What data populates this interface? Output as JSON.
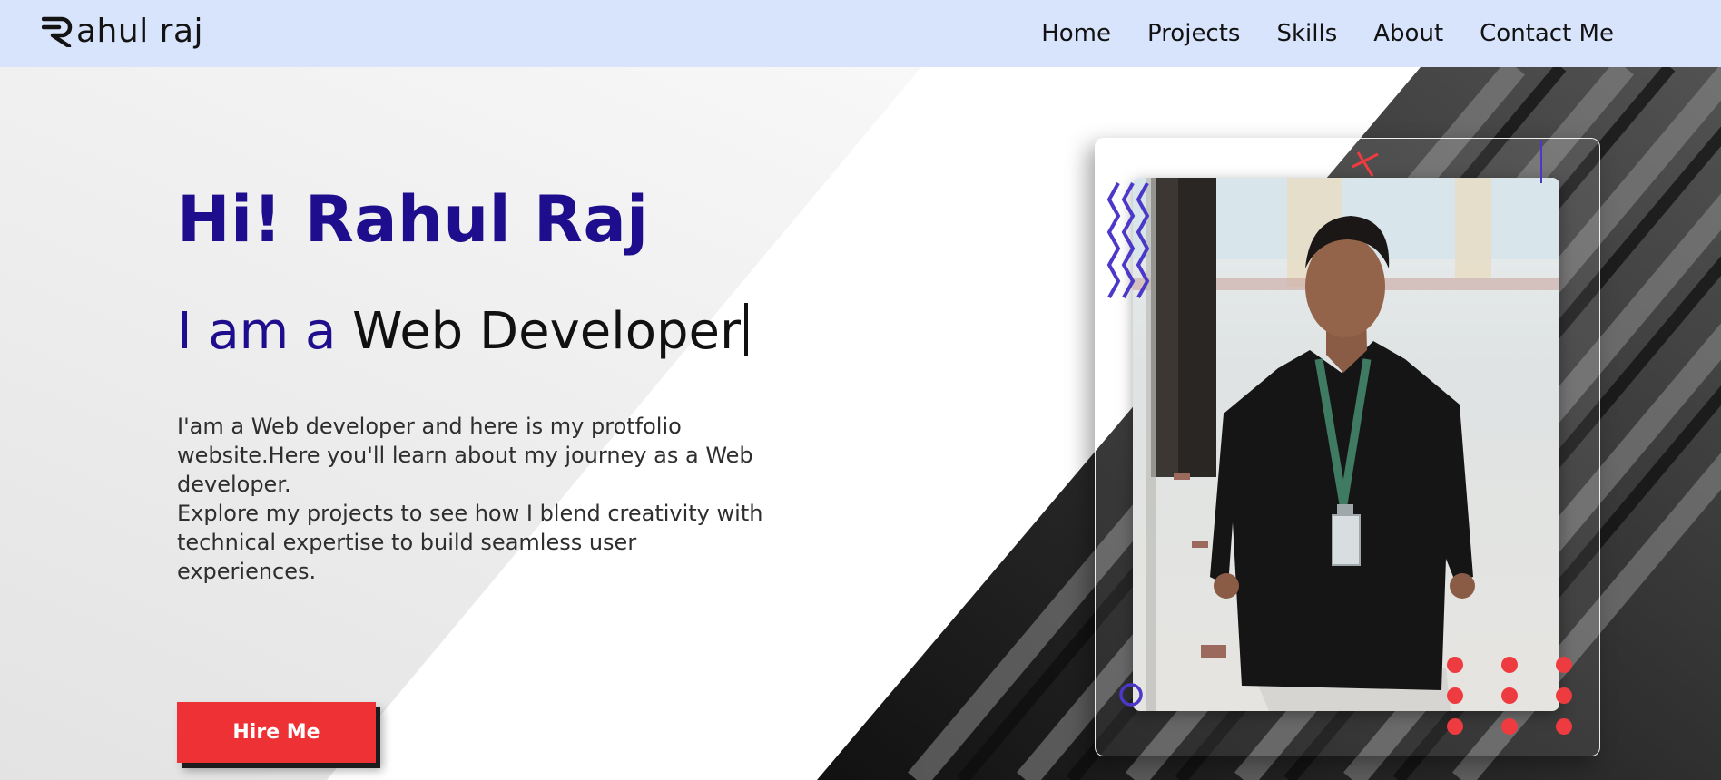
{
  "brand": {
    "name": "ahul raj",
    "logo_letter": "R"
  },
  "nav": {
    "items": [
      {
        "label": "Home"
      },
      {
        "label": "Projects"
      },
      {
        "label": "Skills"
      },
      {
        "label": "About"
      },
      {
        "label": "Contact Me"
      }
    ]
  },
  "hero": {
    "greeting": "Hi! Rahul Raj",
    "role_prefix": "I am a",
    "role_typed": "Web Developer",
    "intro_p1": "I'am a Web developer and here is my protfolio website.Here you'll learn about my journey as a Web developer.",
    "intro_p2": "Explore my projects to see how I blend creativity with technical expertise to build seamless user experiences.",
    "cta_label": "Hire Me"
  },
  "colors": {
    "nav_bg": "#d8e4fb",
    "accent_blue": "#1e0d8c",
    "cta_red": "#ee3134",
    "decor_red": "#ee3b3f",
    "decor_purple": "#4b38c9"
  },
  "icons": {
    "logo": "stylized-r-logo-icon",
    "cross": "cross-decoration-icon",
    "zigzag": "zigzag-decoration-icon",
    "ring": "ring-decoration-icon",
    "dots": "dot-grid-decoration-icon"
  }
}
